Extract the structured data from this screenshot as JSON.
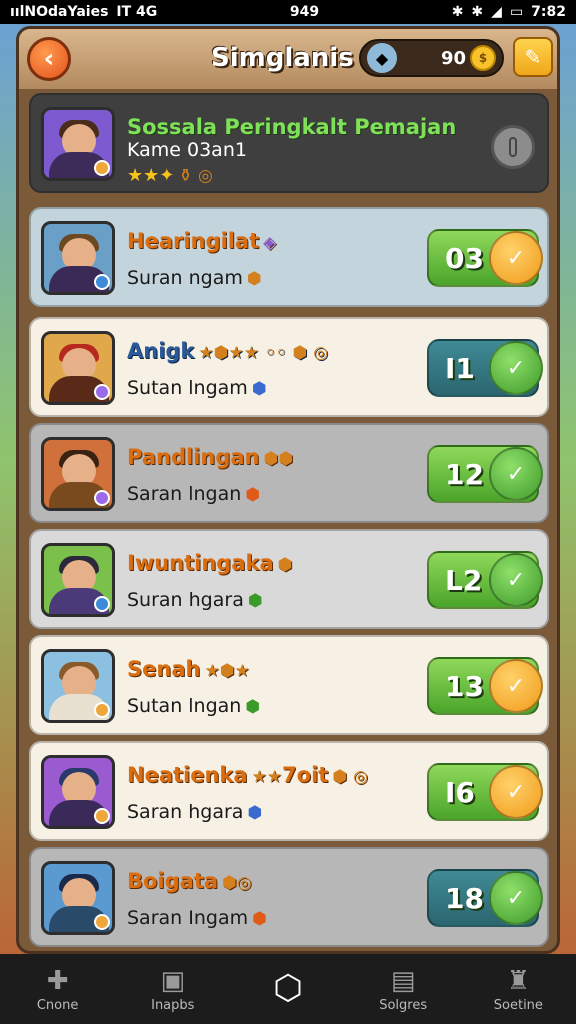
{
  "status_bar": {
    "carrier": "ıılNOdaYaies",
    "network": "IT 4G",
    "time_center": "949",
    "time_right": "7:82",
    "icons": [
      "bluetooth-icon",
      "bluetooth-icon",
      "signal-icon",
      "battery-icon"
    ]
  },
  "header": {
    "title": "Simglanis",
    "back_icon": "chevron-left-icon",
    "currency_value": "90",
    "currency_icon": "gem-icon",
    "coin_icon": "coin-icon",
    "settings_icon": "wrench-icon"
  },
  "rows": [
    {
      "name": "Sossala Peringkalt Pemajan",
      "sub": "Kame 03an1",
      "score": "",
      "style": "top"
    },
    {
      "name": "Hearingilat",
      "sub": "Suran ngam",
      "score": "03",
      "pill": "green",
      "btn": "orange",
      "style": "c-blue"
    },
    {
      "name": "Anigk",
      "sub": "Sutan lngam",
      "score": "I1",
      "pill": "teal",
      "btn": "green",
      "style": "c-cream"
    },
    {
      "name": "Pandlingan",
      "sub": "Saran lngan",
      "score": "12",
      "pill": "green",
      "btn": "green",
      "style": "c-gray"
    },
    {
      "name": "Iwuntingaka",
      "sub": "Suran hgara",
      "score": "L2",
      "pill": "green",
      "btn": "green",
      "style": "c-gray"
    },
    {
      "name": "Senah",
      "sub": "Sutan lngan",
      "score": "13",
      "pill": "green",
      "btn": "orange",
      "style": "c-cream"
    },
    {
      "name": "Neatienka",
      "sub": "Saran hgara",
      "score": "I6",
      "pill": "green",
      "btn": "orange",
      "style": "c-cream"
    },
    {
      "name": "Boigata",
      "sub": "Saran Ingam",
      "score": "18",
      "pill": "teal",
      "btn": "green",
      "style": "c-gray"
    }
  ],
  "row_extra": {
    "name_suffix_6": "7oit"
  },
  "bottom_nav": [
    {
      "label": "Cnone",
      "icon": "puzzle-icon"
    },
    {
      "label": "Inapbs",
      "icon": "box-icon"
    },
    {
      "label": "",
      "icon": "hexagon-icon"
    },
    {
      "label": "Solgres",
      "icon": "card-icon"
    },
    {
      "label": "Soetine",
      "icon": "trophy-icon"
    }
  ]
}
